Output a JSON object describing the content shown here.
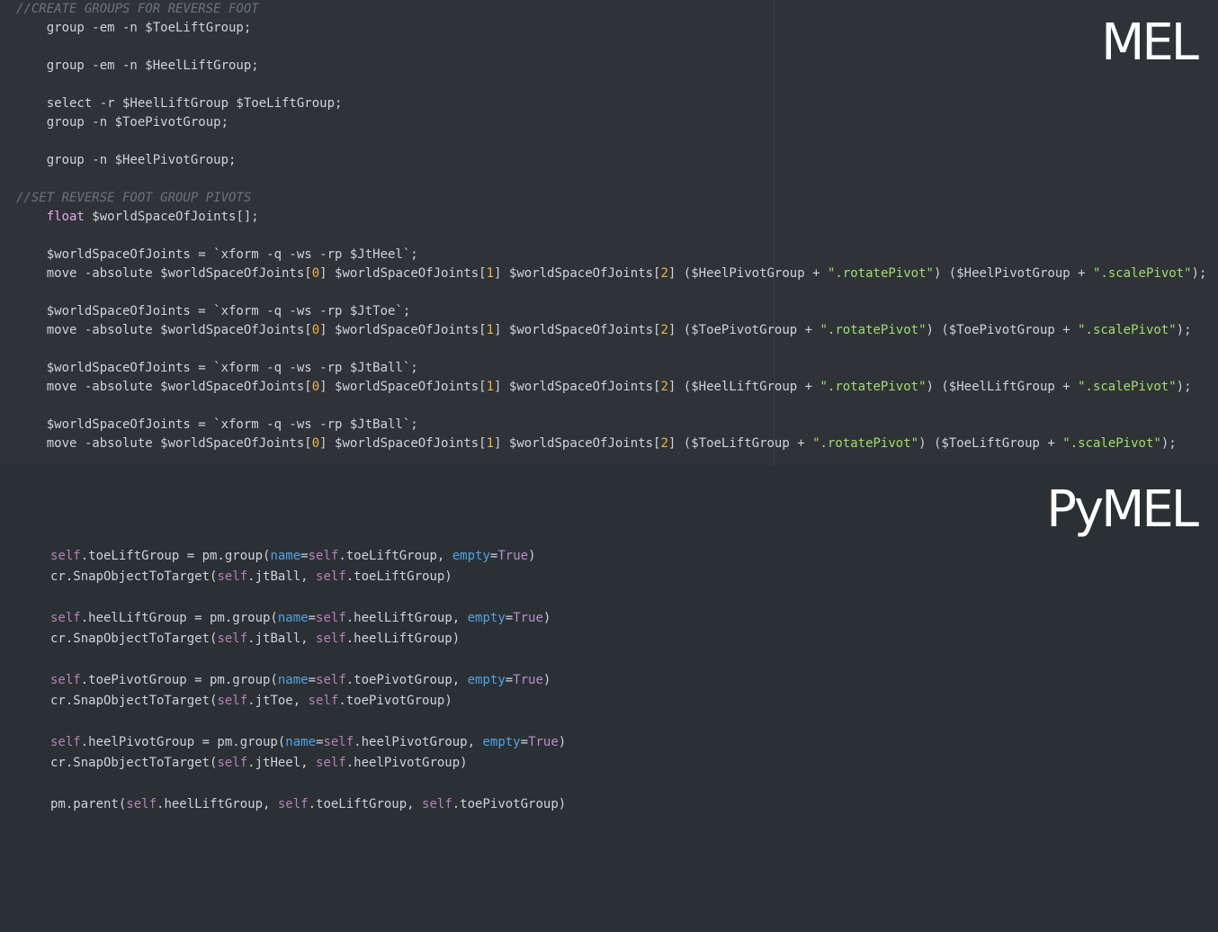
{
  "panels": {
    "mel": {
      "title": "MEL",
      "lines": [
        [
          {
            "t": "//CREATE GROUPS FOR REVERSE FOOT",
            "k": "comment"
          }
        ],
        [
          {
            "t": "    group -em -n $ToeLiftGroup;",
            "k": "plain"
          }
        ],
        [],
        [
          {
            "t": "    group -em -n $HeelLiftGroup;",
            "k": "plain"
          }
        ],
        [],
        [
          {
            "t": "    select -r $HeelLiftGroup $ToeLiftGroup;",
            "k": "plain"
          }
        ],
        [
          {
            "t": "    group -n $ToePivotGroup;",
            "k": "plain"
          }
        ],
        [],
        [
          {
            "t": "    group -n $HeelPivotGroup;",
            "k": "plain"
          }
        ],
        [],
        [
          {
            "t": "//SET REVERSE FOOT GROUP PIVOTS",
            "k": "comment"
          }
        ],
        [
          {
            "t": "    ",
            "k": "plain"
          },
          {
            "t": "float",
            "k": "type"
          },
          {
            "t": " $worldSpaceOfJoints[];",
            "k": "plain"
          }
        ],
        [],
        [
          {
            "t": "    $worldSpaceOfJoints = `xform -q -ws -rp $JtHeel`;",
            "k": "plain"
          }
        ],
        [
          {
            "t": "    move -absolute $worldSpaceOfJoints[",
            "k": "plain"
          },
          {
            "t": "0",
            "k": "number"
          },
          {
            "t": "] $worldSpaceOfJoints[",
            "k": "plain"
          },
          {
            "t": "1",
            "k": "number"
          },
          {
            "t": "] $worldSpaceOfJoints[",
            "k": "plain"
          },
          {
            "t": "2",
            "k": "number"
          },
          {
            "t": "] ($HeelPivotGroup + ",
            "k": "plain"
          },
          {
            "t": "\".rotatePivot\"",
            "k": "string"
          },
          {
            "t": ") ($HeelPivotGroup + ",
            "k": "plain"
          },
          {
            "t": "\".scalePivot\"",
            "k": "string"
          },
          {
            "t": ");",
            "k": "plain"
          }
        ],
        [],
        [
          {
            "t": "    $worldSpaceOfJoints = `xform -q -ws -rp $JtToe`;",
            "k": "plain"
          }
        ],
        [
          {
            "t": "    move -absolute $worldSpaceOfJoints[",
            "k": "plain"
          },
          {
            "t": "0",
            "k": "number"
          },
          {
            "t": "] $worldSpaceOfJoints[",
            "k": "plain"
          },
          {
            "t": "1",
            "k": "number"
          },
          {
            "t": "] $worldSpaceOfJoints[",
            "k": "plain"
          },
          {
            "t": "2",
            "k": "number"
          },
          {
            "t": "] ($ToePivotGroup + ",
            "k": "plain"
          },
          {
            "t": "\".rotatePivot\"",
            "k": "string"
          },
          {
            "t": ") ($ToePivotGroup + ",
            "k": "plain"
          },
          {
            "t": "\".scalePivot\"",
            "k": "string"
          },
          {
            "t": ");",
            "k": "plain"
          }
        ],
        [],
        [
          {
            "t": "    $worldSpaceOfJoints = `xform -q -ws -rp $JtBall`;",
            "k": "plain"
          }
        ],
        [
          {
            "t": "    move -absolute $worldSpaceOfJoints[",
            "k": "plain"
          },
          {
            "t": "0",
            "k": "number"
          },
          {
            "t": "] $worldSpaceOfJoints[",
            "k": "plain"
          },
          {
            "t": "1",
            "k": "number"
          },
          {
            "t": "] $worldSpaceOfJoints[",
            "k": "plain"
          },
          {
            "t": "2",
            "k": "number"
          },
          {
            "t": "] ($HeelLiftGroup + ",
            "k": "plain"
          },
          {
            "t": "\".rotatePivot\"",
            "k": "string"
          },
          {
            "t": ") ($HeelLiftGroup + ",
            "k": "plain"
          },
          {
            "t": "\".scalePivot\"",
            "k": "string"
          },
          {
            "t": ");",
            "k": "plain"
          }
        ],
        [],
        [
          {
            "t": "    $worldSpaceOfJoints = `xform -q -ws -rp $JtBall`;",
            "k": "plain"
          }
        ],
        [
          {
            "t": "    move -absolute $worldSpaceOfJoints[",
            "k": "plain"
          },
          {
            "t": "0",
            "k": "number"
          },
          {
            "t": "] $worldSpaceOfJoints[",
            "k": "plain"
          },
          {
            "t": "1",
            "k": "number"
          },
          {
            "t": "] $worldSpaceOfJoints[",
            "k": "plain"
          },
          {
            "t": "2",
            "k": "number"
          },
          {
            "t": "] ($ToeLiftGroup + ",
            "k": "plain"
          },
          {
            "t": "\".rotatePivot\"",
            "k": "string"
          },
          {
            "t": ") ($ToeLiftGroup + ",
            "k": "plain"
          },
          {
            "t": "\".scalePivot\"",
            "k": "string"
          },
          {
            "t": ");",
            "k": "plain"
          }
        ]
      ]
    },
    "pymel": {
      "title": "PyMEL",
      "lines": [
        [
          {
            "t": "self",
            "k": "self"
          },
          {
            "t": ".toeLiftGroup = pm.group(",
            "k": "plain"
          },
          {
            "t": "name",
            "k": "kwarg"
          },
          {
            "t": "=",
            "k": "plain"
          },
          {
            "t": "self",
            "k": "self"
          },
          {
            "t": ".toeLiftGroup, ",
            "k": "plain"
          },
          {
            "t": "empty",
            "k": "kwarg"
          },
          {
            "t": "=",
            "k": "plain"
          },
          {
            "t": "True",
            "k": "const"
          },
          {
            "t": ")",
            "k": "plain"
          }
        ],
        [
          {
            "t": "cr.SnapObjectToTarget(",
            "k": "plain"
          },
          {
            "t": "self",
            "k": "self"
          },
          {
            "t": ".jtBall, ",
            "k": "plain"
          },
          {
            "t": "self",
            "k": "self"
          },
          {
            "t": ".toeLiftGroup)",
            "k": "plain"
          }
        ],
        [],
        [
          {
            "t": "self",
            "k": "self"
          },
          {
            "t": ".heelLiftGroup = pm.group(",
            "k": "plain"
          },
          {
            "t": "name",
            "k": "kwarg"
          },
          {
            "t": "=",
            "k": "plain"
          },
          {
            "t": "self",
            "k": "self"
          },
          {
            "t": ".heelLiftGroup, ",
            "k": "plain"
          },
          {
            "t": "empty",
            "k": "kwarg"
          },
          {
            "t": "=",
            "k": "plain"
          },
          {
            "t": "True",
            "k": "const"
          },
          {
            "t": ")",
            "k": "plain"
          }
        ],
        [
          {
            "t": "cr.SnapObjectToTarget(",
            "k": "plain"
          },
          {
            "t": "self",
            "k": "self"
          },
          {
            "t": ".jtBall, ",
            "k": "plain"
          },
          {
            "t": "self",
            "k": "self"
          },
          {
            "t": ".heelLiftGroup)",
            "k": "plain"
          }
        ],
        [],
        [
          {
            "t": "self",
            "k": "self"
          },
          {
            "t": ".toePivotGroup = pm.group(",
            "k": "plain"
          },
          {
            "t": "name",
            "k": "kwarg"
          },
          {
            "t": "=",
            "k": "plain"
          },
          {
            "t": "self",
            "k": "self"
          },
          {
            "t": ".toePivotGroup, ",
            "k": "plain"
          },
          {
            "t": "empty",
            "k": "kwarg"
          },
          {
            "t": "=",
            "k": "plain"
          },
          {
            "t": "True",
            "k": "const"
          },
          {
            "t": ")",
            "k": "plain"
          }
        ],
        [
          {
            "t": "cr.SnapObjectToTarget(",
            "k": "plain"
          },
          {
            "t": "self",
            "k": "self"
          },
          {
            "t": ".jtToe, ",
            "k": "plain"
          },
          {
            "t": "self",
            "k": "self"
          },
          {
            "t": ".toePivotGroup)",
            "k": "plain"
          }
        ],
        [],
        [
          {
            "t": "self",
            "k": "self"
          },
          {
            "t": ".heelPivotGroup = pm.group(",
            "k": "plain"
          },
          {
            "t": "name",
            "k": "kwarg"
          },
          {
            "t": "=",
            "k": "plain"
          },
          {
            "t": "self",
            "k": "self"
          },
          {
            "t": ".heelPivotGroup, ",
            "k": "plain"
          },
          {
            "t": "empty",
            "k": "kwarg"
          },
          {
            "t": "=",
            "k": "plain"
          },
          {
            "t": "True",
            "k": "const"
          },
          {
            "t": ")",
            "k": "plain"
          }
        ],
        [
          {
            "t": "cr.SnapObjectToTarget(",
            "k": "plain"
          },
          {
            "t": "self",
            "k": "self"
          },
          {
            "t": ".jtHeel, ",
            "k": "plain"
          },
          {
            "t": "self",
            "k": "self"
          },
          {
            "t": ".heelPivotGroup)",
            "k": "plain"
          }
        ],
        [],
        [
          {
            "t": "pm.parent(",
            "k": "plain"
          },
          {
            "t": "self",
            "k": "self"
          },
          {
            "t": ".heelLiftGroup, ",
            "k": "plain"
          },
          {
            "t": "self",
            "k": "self"
          },
          {
            "t": ".toeLiftGroup, ",
            "k": "plain"
          },
          {
            "t": "self",
            "k": "self"
          },
          {
            "t": ".toePivotGroup)",
            "k": "plain"
          }
        ]
      ]
    }
  },
  "colors": {
    "background_top": "#2f3337",
    "background_bottom": "#2b3034",
    "text": "#cdd3da",
    "comment": "#6b737c",
    "type": "#e6a7e9",
    "number": "#f5b042",
    "string": "#a3dc6d",
    "self": "#b781b8",
    "kwarg": "#4fa3e6",
    "const": "#ba8fcf",
    "title": "#ffffff"
  }
}
